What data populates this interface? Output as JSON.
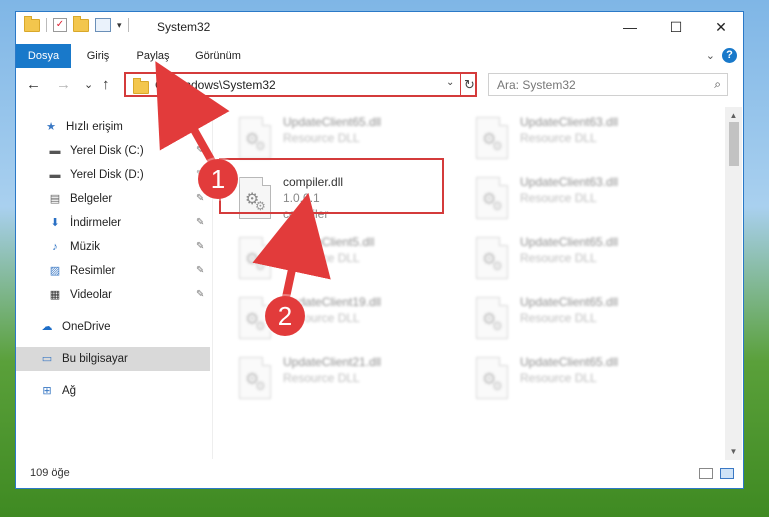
{
  "title_bar": {
    "title": "System32",
    "minimize_glyph": "—",
    "maximize_glyph": "☐",
    "close_glyph": "✕",
    "quick_access_arrow": "▾"
  },
  "ribbon": {
    "tabs": [
      "Dosya",
      "Giriş",
      "Paylaş",
      "Görünüm"
    ],
    "active_tab": "Dosya",
    "expand_glyph": "⌄",
    "help_glyph": "?"
  },
  "nav": {
    "back_glyph": "←",
    "forward_glyph": "→",
    "recent_glyph": "⌄",
    "up_glyph": "↑",
    "address": "C:\\Windows\\System32",
    "address_dropdown_glyph": "⌄",
    "refresh_glyph": "↻",
    "search_placeholder": "Ara: System32",
    "search_glyph": "⌕"
  },
  "sidebar": {
    "items": [
      {
        "label": "Hızlı erişim",
        "icon": "star-icon",
        "glyph": "★",
        "pinned": false
      },
      {
        "label": "Yerel Disk (C:)",
        "icon": "drive-icon",
        "glyph": "▬",
        "pinned": true
      },
      {
        "label": "Yerel Disk (D:)",
        "icon": "drive-icon",
        "glyph": "▬",
        "pinned": true
      },
      {
        "label": "Belgeler",
        "icon": "documents-icon",
        "glyph": "▤",
        "pinned": true
      },
      {
        "label": "İndirmeler",
        "icon": "download-icon",
        "glyph": "⬇",
        "pinned": true
      },
      {
        "label": "Müzik",
        "icon": "music-icon",
        "glyph": "♪",
        "pinned": true
      },
      {
        "label": "Resimler",
        "icon": "pictures-icon",
        "glyph": "▨",
        "pinned": true
      },
      {
        "label": "Videolar",
        "icon": "videos-icon",
        "glyph": "▦",
        "pinned": true
      },
      {
        "label": "OneDrive",
        "icon": "cloud-icon",
        "glyph": "☁",
        "pinned": false
      },
      {
        "label": "Bu bilgisayar",
        "icon": "computer-icon",
        "glyph": "▭",
        "pinned": false,
        "selected": true
      },
      {
        "label": "Ağ",
        "icon": "network-icon",
        "glyph": "⊞",
        "pinned": false
      }
    ],
    "pin_glyph": "✎"
  },
  "files": [
    {
      "name": "UpdateClient65.dll",
      "desc": "Resource DLL",
      "blurred": true
    },
    {
      "name": "UpdateClient63.dll",
      "desc": "Resource DLL",
      "blurred": true
    },
    {
      "name": "compiler.dll",
      "desc": "1.0.0.1",
      "desc2": "compiler",
      "blurred": false
    },
    {
      "name": "UpdateClient63.dll",
      "desc": "Resource DLL",
      "blurred": true
    },
    {
      "name": "UpdateClient5.dll",
      "desc": "Resource DLL",
      "blurred": true
    },
    {
      "name": "UpdateClient65.dll",
      "desc": "Resource DLL",
      "blurred": true
    },
    {
      "name": "UpdateClient19.dll",
      "desc": "Resource DLL",
      "blurred": true
    },
    {
      "name": "UpdateClient65.dll",
      "desc": "Resource DLL",
      "blurred": true
    },
    {
      "name": "UpdateClient21.dll",
      "desc": "Resource DLL",
      "blurred": true
    },
    {
      "name": "UpdateClient65.dll",
      "desc": "Resource DLL",
      "blurred": true
    }
  ],
  "status": {
    "item_count": "109 öğe"
  },
  "annotations": {
    "step1": "1",
    "step2": "2",
    "color": "#e23b3b"
  }
}
